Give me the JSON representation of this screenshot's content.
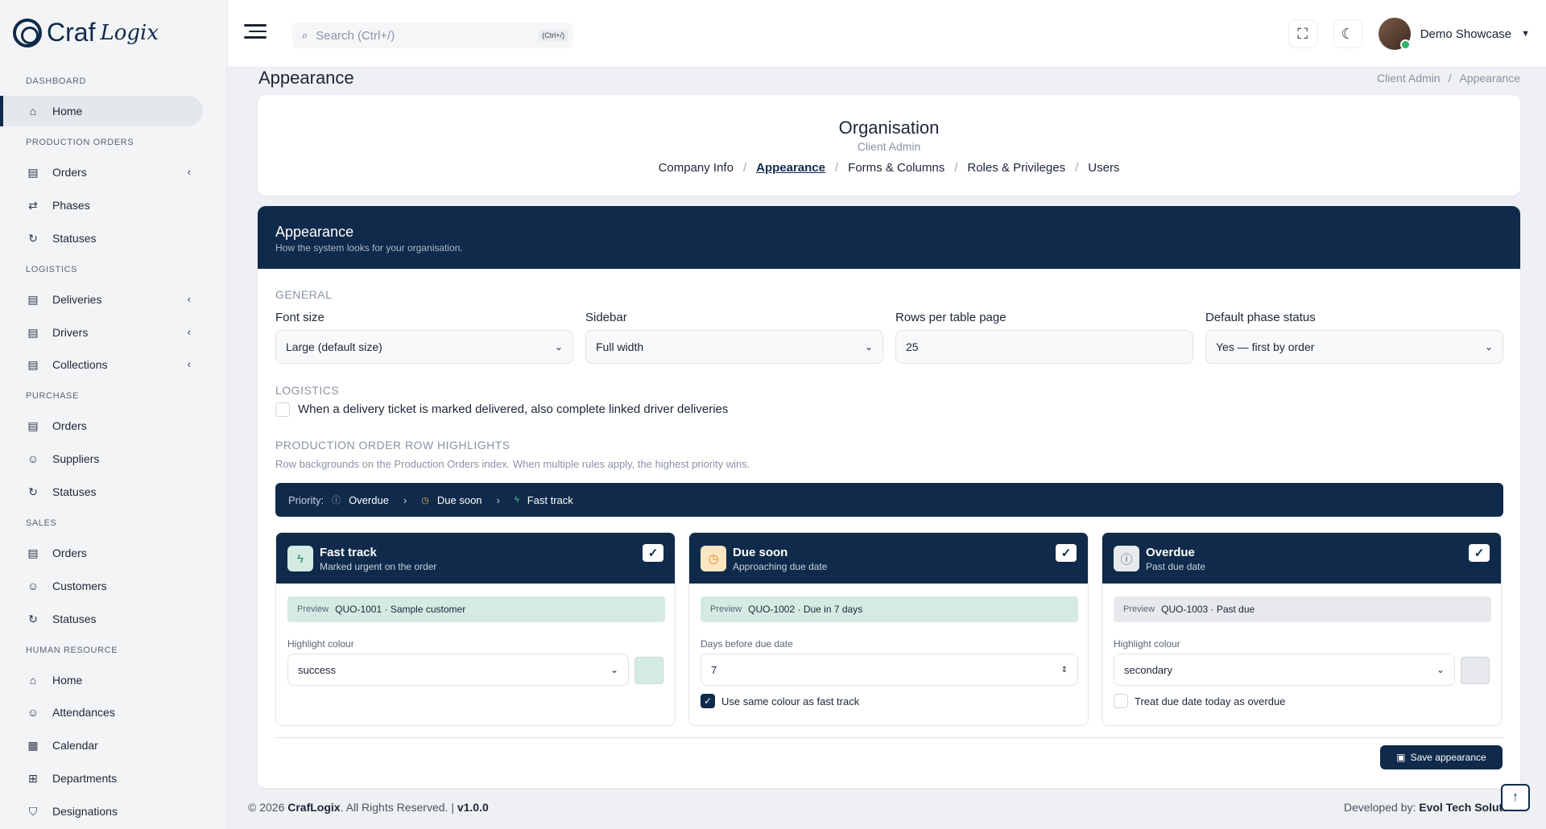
{
  "brand": {
    "name": "Craf",
    "script": "Logix"
  },
  "sidebar": {
    "sections": [
      {
        "label": "DASHBOARD",
        "items": [
          {
            "label": "Home",
            "icon": "home-icon",
            "active": true
          }
        ]
      },
      {
        "label": "PRODUCTION ORDERS",
        "items": [
          {
            "label": "Orders",
            "icon": "document-icon",
            "chevron": true
          },
          {
            "label": "Phases",
            "icon": "repeat-icon"
          },
          {
            "label": "Statuses",
            "icon": "refresh-icon"
          }
        ]
      },
      {
        "label": "LOGISTICS",
        "items": [
          {
            "label": "Deliveries",
            "icon": "document-icon",
            "chevron": true
          },
          {
            "label": "Drivers",
            "icon": "document-icon",
            "chevron": true
          },
          {
            "label": "Collections",
            "icon": "document-icon",
            "chevron": true
          }
        ]
      },
      {
        "label": "PURCHASE",
        "items": [
          {
            "label": "Orders",
            "icon": "document-icon"
          },
          {
            "label": "Suppliers",
            "icon": "user-icon"
          },
          {
            "label": "Statuses",
            "icon": "refresh-icon"
          }
        ]
      },
      {
        "label": "SALES",
        "items": [
          {
            "label": "Orders",
            "icon": "document-icon"
          },
          {
            "label": "Customers",
            "icon": "user-icon"
          },
          {
            "label": "Statuses",
            "icon": "refresh-icon"
          }
        ]
      },
      {
        "label": "HUMAN RESOURCE",
        "items": [
          {
            "label": "Home",
            "icon": "home-icon"
          },
          {
            "label": "Attendances",
            "icon": "user-check-icon"
          },
          {
            "label": "Calendar",
            "icon": "calendar-icon"
          },
          {
            "label": "Departments",
            "icon": "grid-icon"
          },
          {
            "label": "Designations",
            "icon": "shield-icon"
          }
        ]
      }
    ]
  },
  "topbar": {
    "search_placeholder": "Search (Ctrl+/)",
    "search_kbd": "(Ctrl+/)",
    "user_name": "Demo Showcase"
  },
  "page": {
    "title": "Appearance",
    "breadcrumb": [
      "Client Admin",
      "Appearance"
    ]
  },
  "org": {
    "title": "Organisation",
    "subtitle": "Client Admin",
    "tabs": [
      "Company Info",
      "Appearance",
      "Forms & Columns",
      "Roles & Privileges",
      "Users"
    ],
    "current_tab": "Appearance"
  },
  "panel": {
    "title": "Appearance",
    "subtitle": "How the system looks for your organisation.",
    "general_label": "GENERAL",
    "fields": {
      "font_size": {
        "label": "Font size",
        "value": "Large (default size)"
      },
      "sidebar": {
        "label": "Sidebar",
        "value": "Full width"
      },
      "rows": {
        "label": "Rows per table page",
        "value": "25"
      },
      "phase": {
        "label": "Default phase status",
        "value": "Yes — first by order"
      }
    },
    "logistics_label": "LOGISTICS",
    "logistics_check": "When a delivery ticket is marked delivered, also complete linked driver deliveries",
    "highlights_label": "PRODUCTION ORDER ROW HIGHLIGHTS",
    "highlights_desc": "Row backgrounds on the Production Orders index. When multiple rules apply, the highest priority wins.",
    "priority": {
      "label": "Priority:",
      "items": [
        "Overdue",
        "Due soon",
        "Fast track"
      ]
    },
    "cards": [
      {
        "title": "Fast track",
        "subtitle": "Marked urgent on the order",
        "preview_label": "Preview",
        "preview_text": "QUO-1001 · Sample customer",
        "field_label": "Highlight colour",
        "field_value": "success",
        "preview_bg": "#d3ebe2",
        "icon_bg": "#d3ebe2",
        "icon": "lightning-icon"
      },
      {
        "title": "Due soon",
        "subtitle": "Approaching due date",
        "preview_label": "Preview",
        "preview_text": "QUO-1002 · Due in 7 days",
        "field_label": "Days before due date",
        "field_value": "7",
        "check_label": "Use same colour as fast track",
        "preview_bg": "#d3ebe2",
        "icon_bg": "#fbe6c2",
        "icon": "clock-icon"
      },
      {
        "title": "Overdue",
        "subtitle": "Past due date",
        "preview_label": "Preview",
        "preview_text": "QUO-1003 · Past due",
        "field_label": "Highlight colour",
        "field_value": "secondary",
        "check_label": "Treat due date today as overdue",
        "preview_bg": "#e7e9ec",
        "icon_bg": "#e7e9ec",
        "icon": "alert-icon"
      }
    ],
    "save_label": "Save appearance"
  },
  "footer": {
    "copyright_prefix": "© 2026 ",
    "company": "CrafLogix",
    "rights": ". All Rights Reserved. | ",
    "version": "v1.0.0",
    "developed_by": "Developed by: ",
    "developer": "Evol Tech Solutions"
  },
  "colors": {
    "navy": "#0f2a4a",
    "success": "#d3ebe2",
    "secondary": "#e7e9ec"
  }
}
